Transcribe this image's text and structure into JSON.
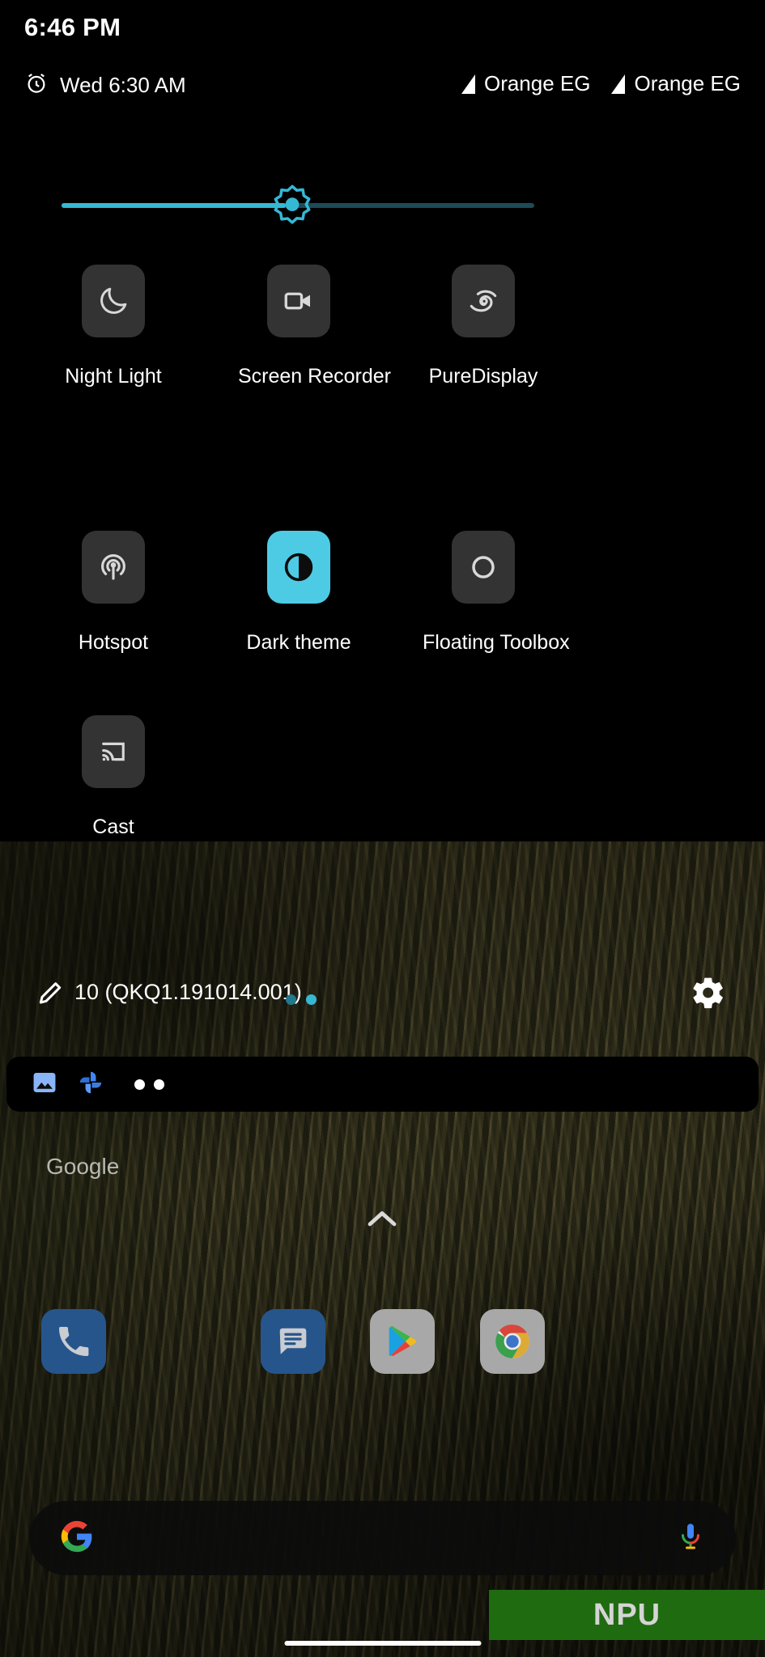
{
  "status_bar": {
    "clock": "6:46 PM"
  },
  "qs_header": {
    "alarm_icon": "alarm-clock-icon",
    "alarm_text": "Wed 6:30 AM",
    "carriers": [
      {
        "icon": "signal-triangle-icon",
        "label": "Orange EG"
      },
      {
        "icon": "signal-triangle-icon",
        "label": "Orange EG"
      }
    ]
  },
  "brightness": {
    "icon": "brightness-sun-icon",
    "value_percent": 47,
    "track_color": "#1d4b57",
    "fill_color": "#35b8d4"
  },
  "tiles": [
    {
      "label": "Night Light",
      "icon": "moon-icon",
      "active": false
    },
    {
      "label": "Screen Recorder",
      "icon": "video-camera-icon",
      "active": false
    },
    {
      "label": "PureDisplay",
      "icon": "puredisplay-eye-icon",
      "active": false
    },
    {
      "label": "Hotspot",
      "icon": "hotspot-broadcast-icon",
      "active": false
    },
    {
      "label": "Dark theme",
      "icon": "contrast-circle-icon",
      "active": true
    },
    {
      "label": "Floating Toolbox",
      "icon": "circle-outline-icon",
      "active": false
    },
    {
      "label": "Cast",
      "icon": "cast-screen-icon",
      "active": false
    }
  ],
  "qs_footer": {
    "edit_icon": "pencil-edit-icon",
    "build_text": "10 (QKQ1.191014.001)",
    "page_dots": [
      {
        "state": "inactive",
        "color": "#20798c"
      },
      {
        "state": "active",
        "color": "#35b8d4"
      }
    ],
    "settings_icon": "gear-icon"
  },
  "notification_strip": {
    "icons": [
      {
        "name": "photo-image-icon",
        "color": "#8ab4f8"
      },
      {
        "name": "google-photos-icon",
        "color": "#4285f4"
      }
    ],
    "overflow_dots": 2
  },
  "home_screen": {
    "widget_label": "Google",
    "page_chevron_icon": "chevron-up-icon",
    "dock_apps": [
      {
        "name": "Phone",
        "icon": "phone-handset-icon",
        "bg": "#26558c"
      },
      {
        "name": "Messages",
        "icon": "messages-bubble-icon",
        "bg": "#26558c"
      },
      {
        "name": "Play Store",
        "icon": "play-store-icon",
        "bg": "#a8a8a8"
      },
      {
        "name": "Chrome",
        "icon": "chrome-icon",
        "bg": "#a8a8a8"
      }
    ],
    "search_bar": {
      "left_icon": "google-g-icon",
      "right_icon": "microphone-icon",
      "placeholder": ""
    }
  },
  "watermark": {
    "text": "NPU",
    "background": "#1f6b10"
  },
  "accent_colors": {
    "cyan": "#4ecbe4",
    "slider": "#35b8d4",
    "tile_bg": "#333333",
    "panel_bg": "#000000"
  }
}
